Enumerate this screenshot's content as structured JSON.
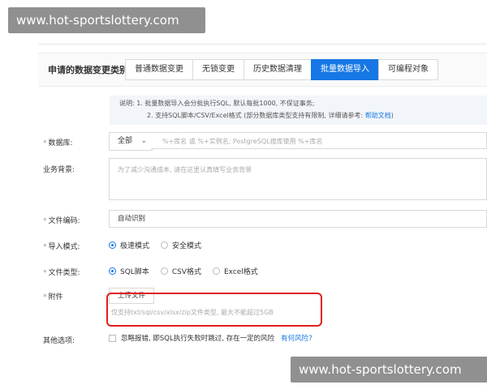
{
  "watermarks": {
    "top": "www.hot-sportslottery.com",
    "bottom": "www.hot-sportslottery.com"
  },
  "header": {
    "label": "申请的数据变更类别:",
    "tabs": [
      {
        "label": "普通数据变更",
        "active": false
      },
      {
        "label": "无锁变更",
        "active": false
      },
      {
        "label": "历史数据清理",
        "active": false
      },
      {
        "label": "批量数据导入",
        "active": true
      },
      {
        "label": "可编程对象",
        "active": false
      }
    ]
  },
  "note": {
    "line1": "说明: 1. 批量数据导入会分批执行SQL, 默认每批1000, 不保证事务;",
    "line2_prefix": "2. 支持SQL脚本/CSV/Excel格式 (部分数据库类型支持有限制, 详细请参考:",
    "line2_link": "帮助文档",
    "line2_suffix": ")"
  },
  "database": {
    "label": "数据库:",
    "select_value": "全部",
    "placeholder": "%+库名 或 %+实例名; PostgreSQL搜库使用 %+库名"
  },
  "background": {
    "label": "业务背景:",
    "placeholder": "为了减少沟通成本, 请在这里认真填写业务背景"
  },
  "encoding": {
    "label": "文件编码:",
    "value": "自动识别"
  },
  "import_mode": {
    "label": "导入模式:",
    "options": [
      {
        "label": "极速模式",
        "selected": true
      },
      {
        "label": "安全模式",
        "selected": false
      }
    ]
  },
  "file_type": {
    "label": "文件类型:",
    "options": [
      {
        "label": "SQL脚本",
        "selected": true
      },
      {
        "label": "CSV格式",
        "selected": false
      },
      {
        "label": "Excel格式",
        "selected": false
      }
    ]
  },
  "attachment": {
    "label": "附件",
    "button": "上传文件",
    "hint": "仅支持txt/sql/csv/xlsx/zip文件类型, 最大不能超过5GB"
  },
  "other": {
    "label": "其他选项:",
    "checkbox_label": "忽略报错, 即SQL执行失败时跳过, 存在一定的风险",
    "link": "有何风险?"
  },
  "colors": {
    "accent": "#1677e5",
    "highlight": "#e11d1d"
  }
}
